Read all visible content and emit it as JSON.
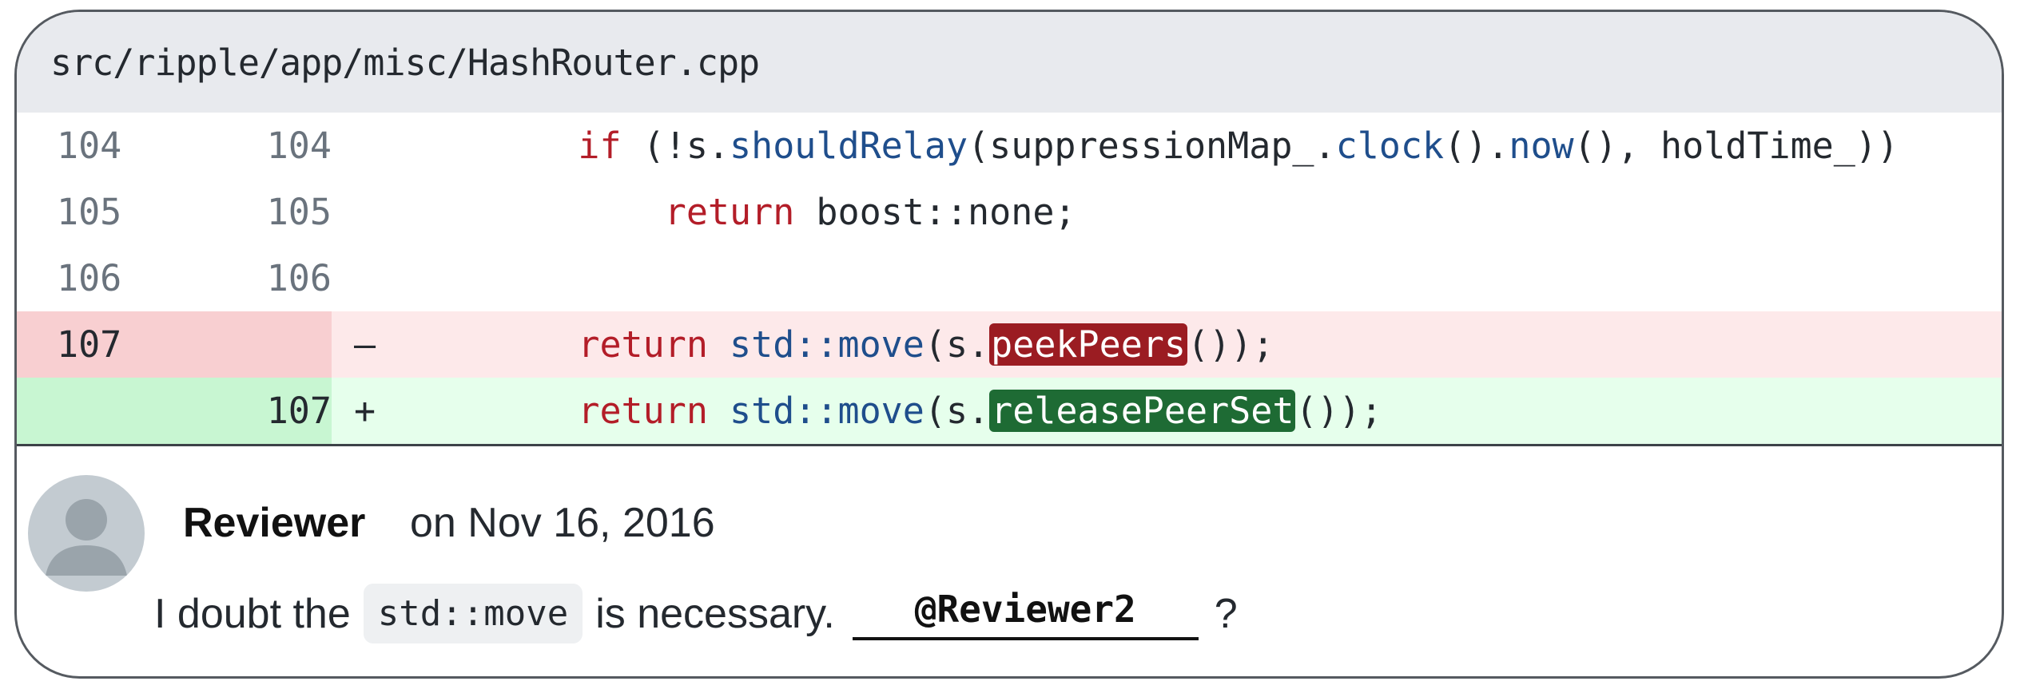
{
  "file": {
    "path": "src/ripple/app/misc/HashRouter.cpp"
  },
  "diff": {
    "rows": [
      {
        "old": "104",
        "new": "104",
        "marker": "",
        "type": "context"
      },
      {
        "old": "105",
        "new": "105",
        "marker": "",
        "type": "context"
      },
      {
        "old": "106",
        "new": "106",
        "marker": "",
        "type": "context"
      },
      {
        "old": "107",
        "new": "",
        "marker": "–",
        "type": "del"
      },
      {
        "old": "",
        "new": "107",
        "marker": "+",
        "type": "add"
      }
    ],
    "code": {
      "l104": {
        "indent": "    ",
        "kw": "if",
        "p1": " (!s.",
        "fn1": "shouldRelay",
        "p2": "(suppressionMap_.",
        "fn2": "clock",
        "p3": "().",
        "fn3": "now",
        "p4": "(), holdTime_))"
      },
      "l105": {
        "indent": "        ",
        "kw": "return",
        "rest": " boost::none;"
      },
      "l107del": {
        "indent": "    ",
        "kw": "return",
        "sp": " ",
        "fn": "std::move",
        "p1": "(s.",
        "hl": "peekPeers",
        "p2": "());"
      },
      "l107add": {
        "indent": "    ",
        "kw": "return",
        "sp": " ",
        "fn": "std::move",
        "p1": "(s.",
        "hl": "releasePeerSet",
        "p2": "());"
      }
    }
  },
  "comment": {
    "author": "Reviewer",
    "date": "on Nov 16, 2016",
    "text_before": "I doubt the",
    "code": "std::move",
    "text_after": "is necessary.",
    "mention": "@Reviewer2",
    "question_mark": "?"
  },
  "colors": {
    "del_highlight": "#9b1c22",
    "add_highlight": "#1e6b34",
    "keyword": "#b31d28",
    "function": "#1f4e8c"
  }
}
